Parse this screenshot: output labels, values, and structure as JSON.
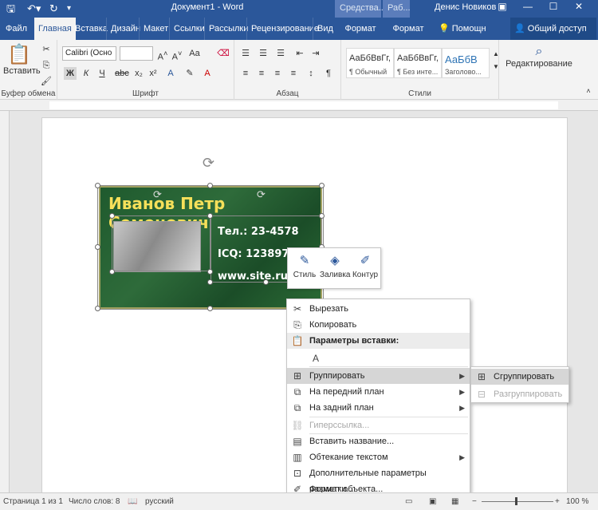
{
  "titlebar": {
    "title": "Документ1 - Word",
    "ctx_tab_1": "Средства...",
    "ctx_tab_2": "Раб...",
    "user": "Денис Новиков",
    "save_icon": "save-icon",
    "undo_icon": "undo-icon",
    "redo_icon": "redo-icon"
  },
  "tabs": [
    {
      "label": "Файл"
    },
    {
      "label": "Главная"
    },
    {
      "label": "Вставка"
    },
    {
      "label": "Дизайн"
    },
    {
      "label": "Макет"
    },
    {
      "label": "Ссылки"
    },
    {
      "label": "Рассылки"
    },
    {
      "label": "Рецензирование"
    },
    {
      "label": "Вид"
    },
    {
      "label": "Формат"
    },
    {
      "label": "Формат"
    }
  ],
  "help": "Помощн",
  "share": "Общий доступ",
  "ribbon": {
    "paste_label": "Вставить",
    "clipboard_label": "Буфер обмена",
    "font_name": "Calibri (Осно",
    "font_label": "Шрифт",
    "paragraph_label": "Абзац",
    "styles_label": "Стили",
    "editing_label": "Редактирование",
    "styles": [
      {
        "sample": "АаБбВвГг,",
        "name": "¶ Обычный"
      },
      {
        "sample": "АаБбВвГг,",
        "name": "¶ Без инте..."
      },
      {
        "sample": "АаБбВ",
        "name": "Заголово..."
      }
    ],
    "bold": "Ж",
    "italic": "К",
    "underline": "Ч"
  },
  "card": {
    "name": "Иванов Петр Семенович",
    "phone": "Тел.: 23-4578",
    "icq": "ICQ: 12389756",
    "site": "www.site.ru"
  },
  "minitoolbar": {
    "style": "Стиль",
    "fill": "Заливка",
    "outline": "Контур"
  },
  "context_menu": {
    "cut": "Вырезать",
    "copy": "Копировать",
    "paste_options": "Параметры вставки:",
    "group": "Группировать",
    "bring_front": "На передний план",
    "send_back": "На задний план",
    "hyperlink": "Гиперссылка...",
    "caption": "Вставить название...",
    "wrap": "Обтекание текстом",
    "layout_options": "Дополнительные параметры разметки...",
    "format_object": "Формат объекта..."
  },
  "submenu": {
    "group": "Сгруппировать",
    "ungroup": "Разгруппировать"
  },
  "statusbar": {
    "page": "Страница 1 из 1",
    "words": "Число слов: 8",
    "lang": "русский",
    "zoom": "100 %"
  },
  "colors": {
    "accent": "#2b579a",
    "card_bg": "#1f5a2e",
    "card_name": "#f6e05a"
  }
}
